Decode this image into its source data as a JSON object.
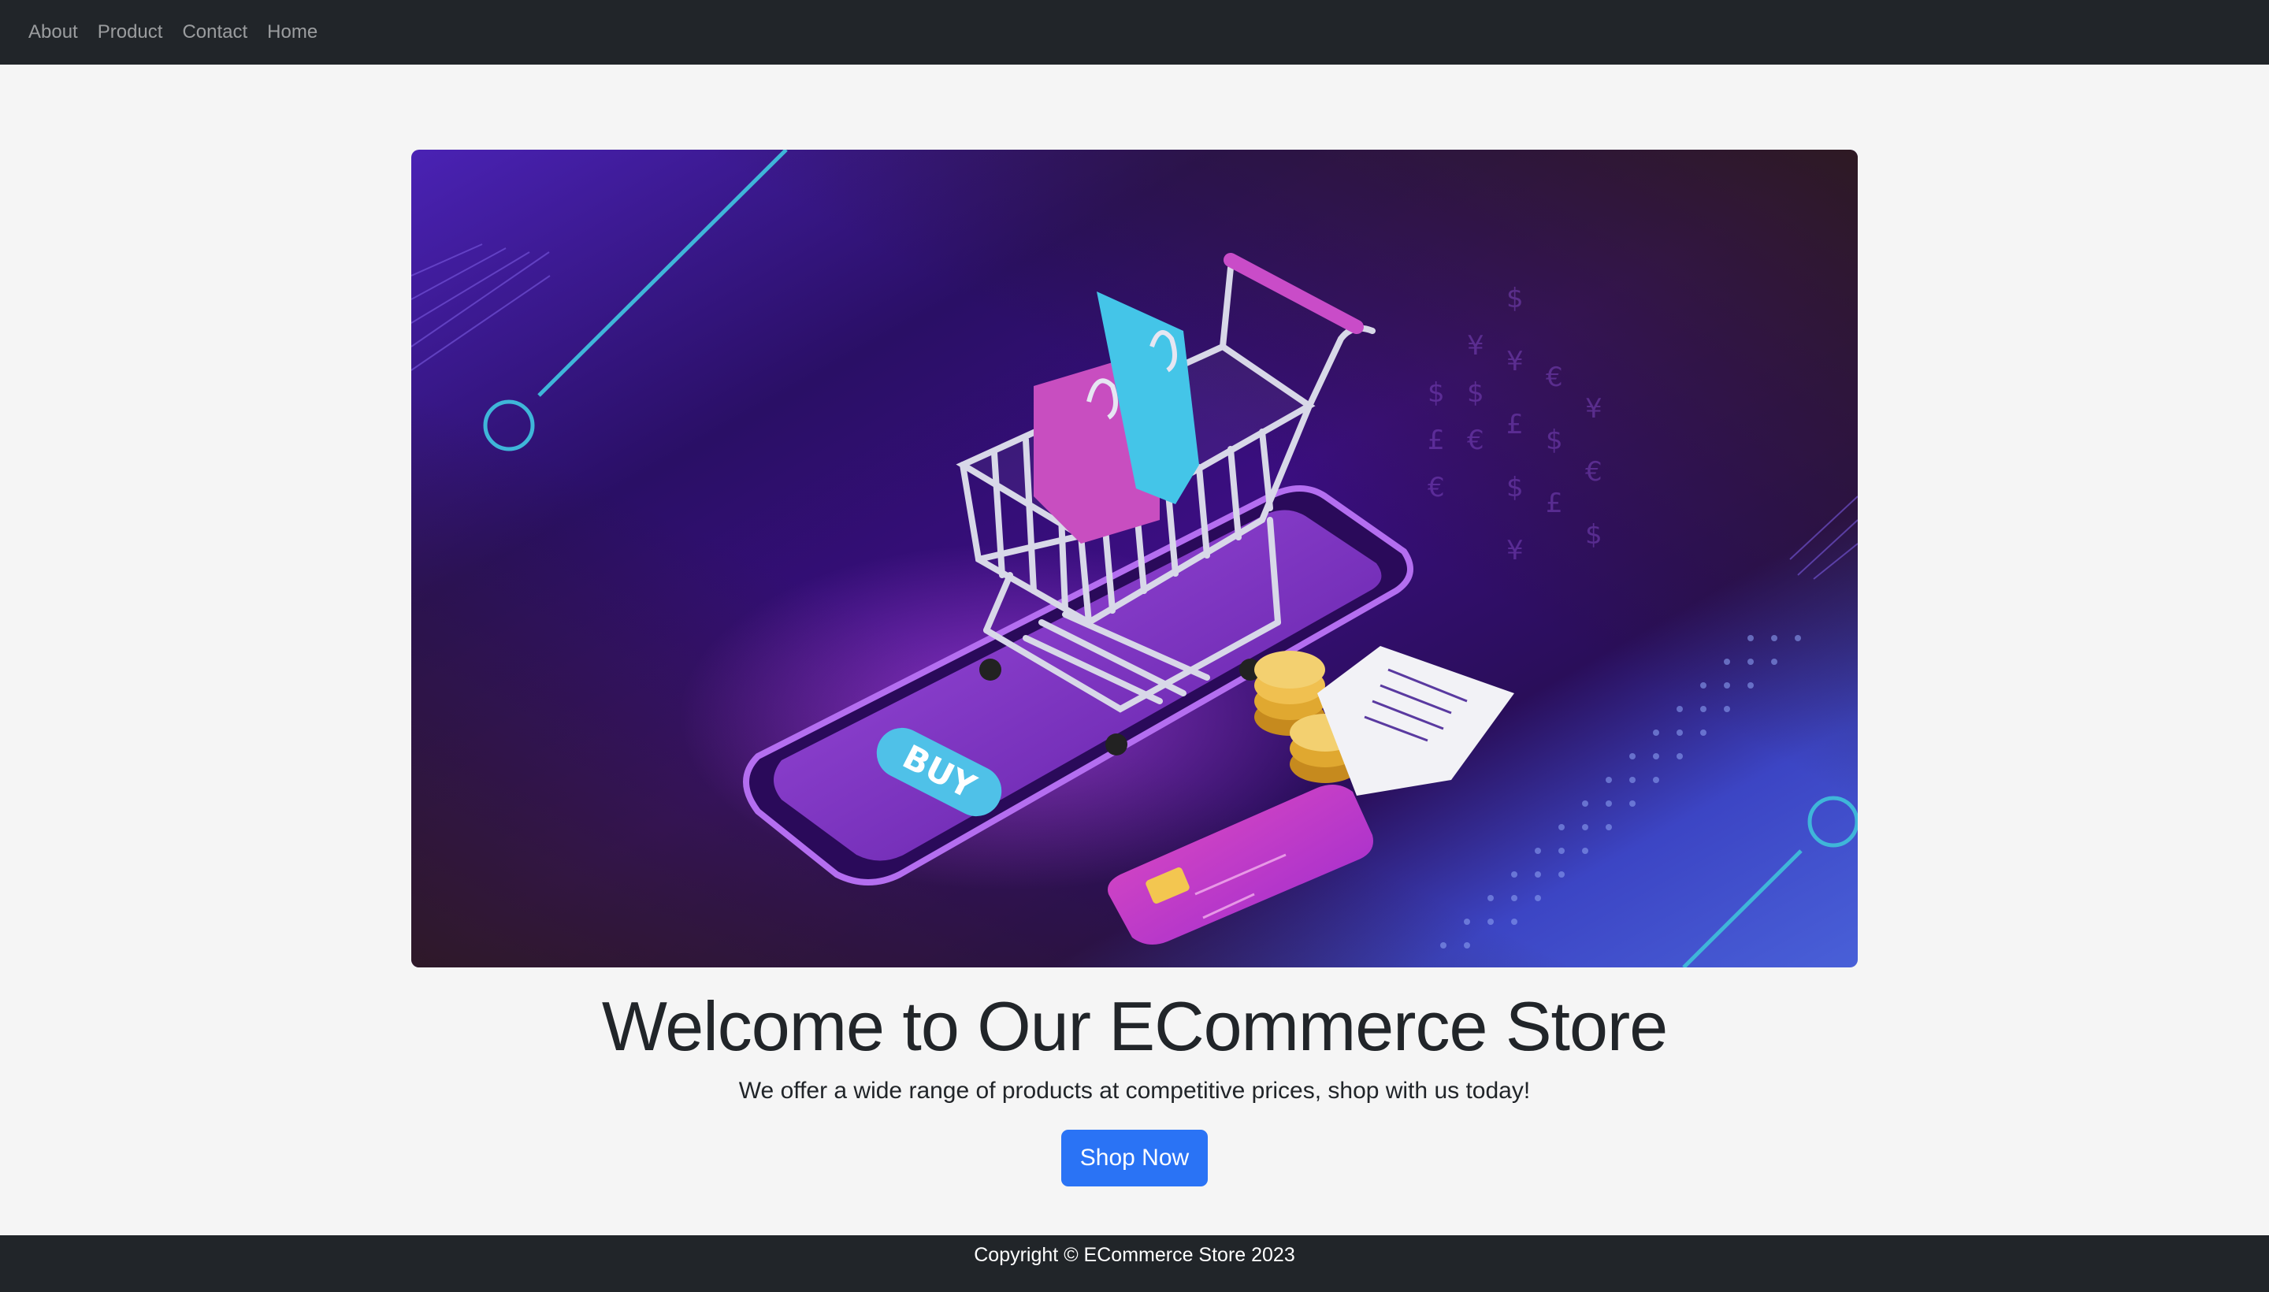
{
  "nav": {
    "items": [
      {
        "label": "About"
      },
      {
        "label": "Product"
      },
      {
        "label": "Contact"
      },
      {
        "label": "Home"
      }
    ]
  },
  "hero": {
    "image_icon": "shopping-cart-illustration-icon",
    "buy_label": "BUY"
  },
  "main": {
    "title": "Welcome to Our ECommerce Store",
    "lead": "We offer a wide range of products at competitive prices, shop with us today!",
    "cta_label": "Shop Now"
  },
  "footer": {
    "text": "Copyright © ECommerce Store 2023"
  },
  "colors": {
    "navbar": "#212529",
    "page_bg": "#f5f5f5",
    "button": "#2a73f5",
    "footer": "#212529"
  }
}
